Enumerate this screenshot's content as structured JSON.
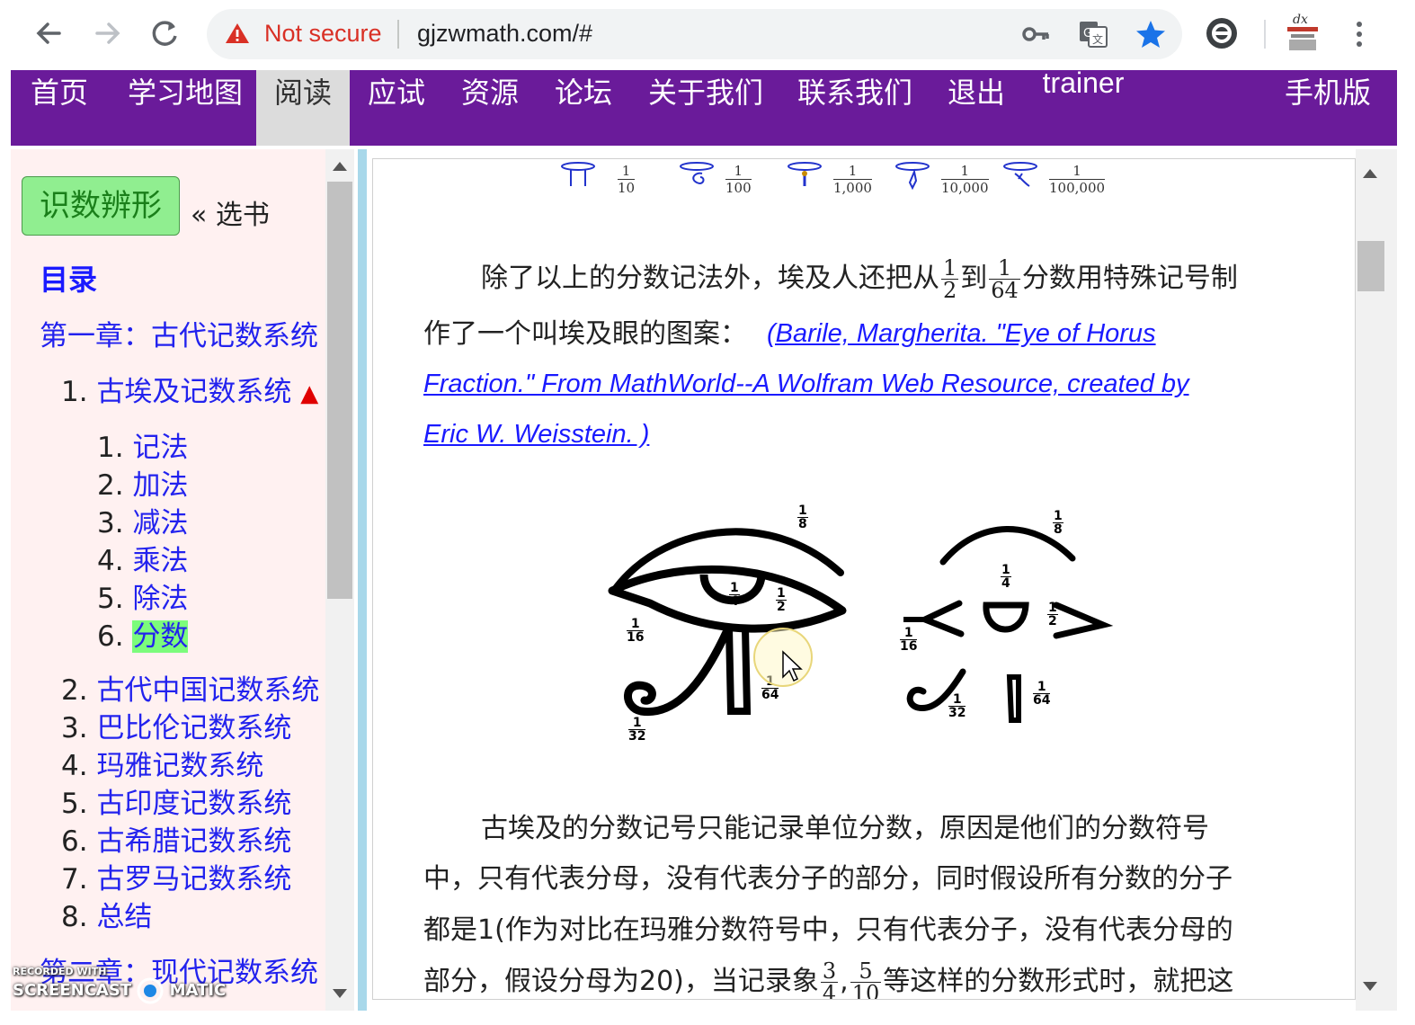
{
  "browser": {
    "security_label": "Not secure",
    "url": "gjzwmath.com/#",
    "profile_label": "dx"
  },
  "topnav": {
    "items": [
      {
        "label": "首页"
      },
      {
        "label": "学习地图"
      },
      {
        "label": "阅读"
      },
      {
        "label": "应试"
      },
      {
        "label": "资源"
      },
      {
        "label": "论坛"
      },
      {
        "label": "关于我们"
      },
      {
        "label": "联系我们"
      },
      {
        "label": "退出"
      }
    ],
    "user": "trainer",
    "mobile": "手机版",
    "active": "阅读",
    "colors": {
      "bar": "#6a1b9a",
      "active_bg": "#dcdcdc"
    }
  },
  "sidebar": {
    "book_button": "识数辨形",
    "select_book": "« 选书",
    "toc_title": "目录",
    "chapter1": "第一章：古代记数系统",
    "section1_num": "1.",
    "section1_label": "古埃及记数系统",
    "section1_marker": "▲",
    "subsections": [
      {
        "num": "1.",
        "label": "记法"
      },
      {
        "num": "2.",
        "label": "加法"
      },
      {
        "num": "3.",
        "label": "减法"
      },
      {
        "num": "4.",
        "label": "乘法"
      },
      {
        "num": "5.",
        "label": "除法"
      },
      {
        "num": "6.",
        "label": "分数"
      }
    ],
    "sections": [
      {
        "num": "2.",
        "label": "古代中国记数系统"
      },
      {
        "num": "3.",
        "label": "巴比伦记数系统"
      },
      {
        "num": "4.",
        "label": "玛雅记数系统"
      },
      {
        "num": "5.",
        "label": "古印度记数系统"
      },
      {
        "num": "6.",
        "label": "古希腊记数系统"
      },
      {
        "num": "7.",
        "label": "古罗马记数系统"
      },
      {
        "num": "8.",
        "label": "总结"
      }
    ],
    "chapter2": "第二章：现代记数系统"
  },
  "content": {
    "glyph_fractions": [
      {
        "n": "1",
        "d": "10"
      },
      {
        "n": "1",
        "d": "100"
      },
      {
        "n": "1",
        "d": "1,000"
      },
      {
        "n": "1",
        "d": "10,000"
      },
      {
        "n": "1",
        "d": "100,000"
      }
    ],
    "para1_a": "除了以上的分数记法外，埃及人还把从",
    "para1_f1": {
      "n": "1",
      "d": "2"
    },
    "para1_b": "到",
    "para1_f2": {
      "n": "1",
      "d": "64"
    },
    "para1_c": "分数用特殊记号制",
    "para1_d": "作了一个叫埃及眼的图案：",
    "citation_1": "(Barile, Margherita. \"Eye of Horus",
    "citation_2": "Fraction.\" From MathWorld--A Wolfram Web Resource, created by",
    "citation_3": "Eric W. Weisstein. )",
    "eye_fractions": {
      "eighth": {
        "n": "1",
        "d": "8"
      },
      "quarter": {
        "n": "1",
        "d": "4"
      },
      "half": {
        "n": "1",
        "d": "2"
      },
      "sixteenth": {
        "n": "1",
        "d": "16"
      },
      "thirtysecond": {
        "n": "1",
        "d": "32"
      },
      "sixtyfourth": {
        "n": "1",
        "d": "64"
      }
    },
    "para2_l1": "古埃及的分数记号只能记录单位分数，原因是他们的分数符号",
    "para2_l2": "中，只有代表分母，没有代表分子的部分，同时假设所有分数的分子",
    "para2_l3": "都是1(作为对比在玛雅分数符号中，只有代表分子，没有代表分母的",
    "para2_l4a": "部分，假设分母为20)，当记录象",
    "para2_f1": {
      "n": "3",
      "d": "4"
    },
    "para2_sep": ",",
    "para2_f2": {
      "n": "5",
      "d": "10"
    },
    "para2_l4b": "等这样的分数形式时，就把这"
  },
  "watermark": {
    "line1": "RECORDED WITH",
    "line2a": "SCREENCAST",
    "line2b": "MATIC"
  }
}
